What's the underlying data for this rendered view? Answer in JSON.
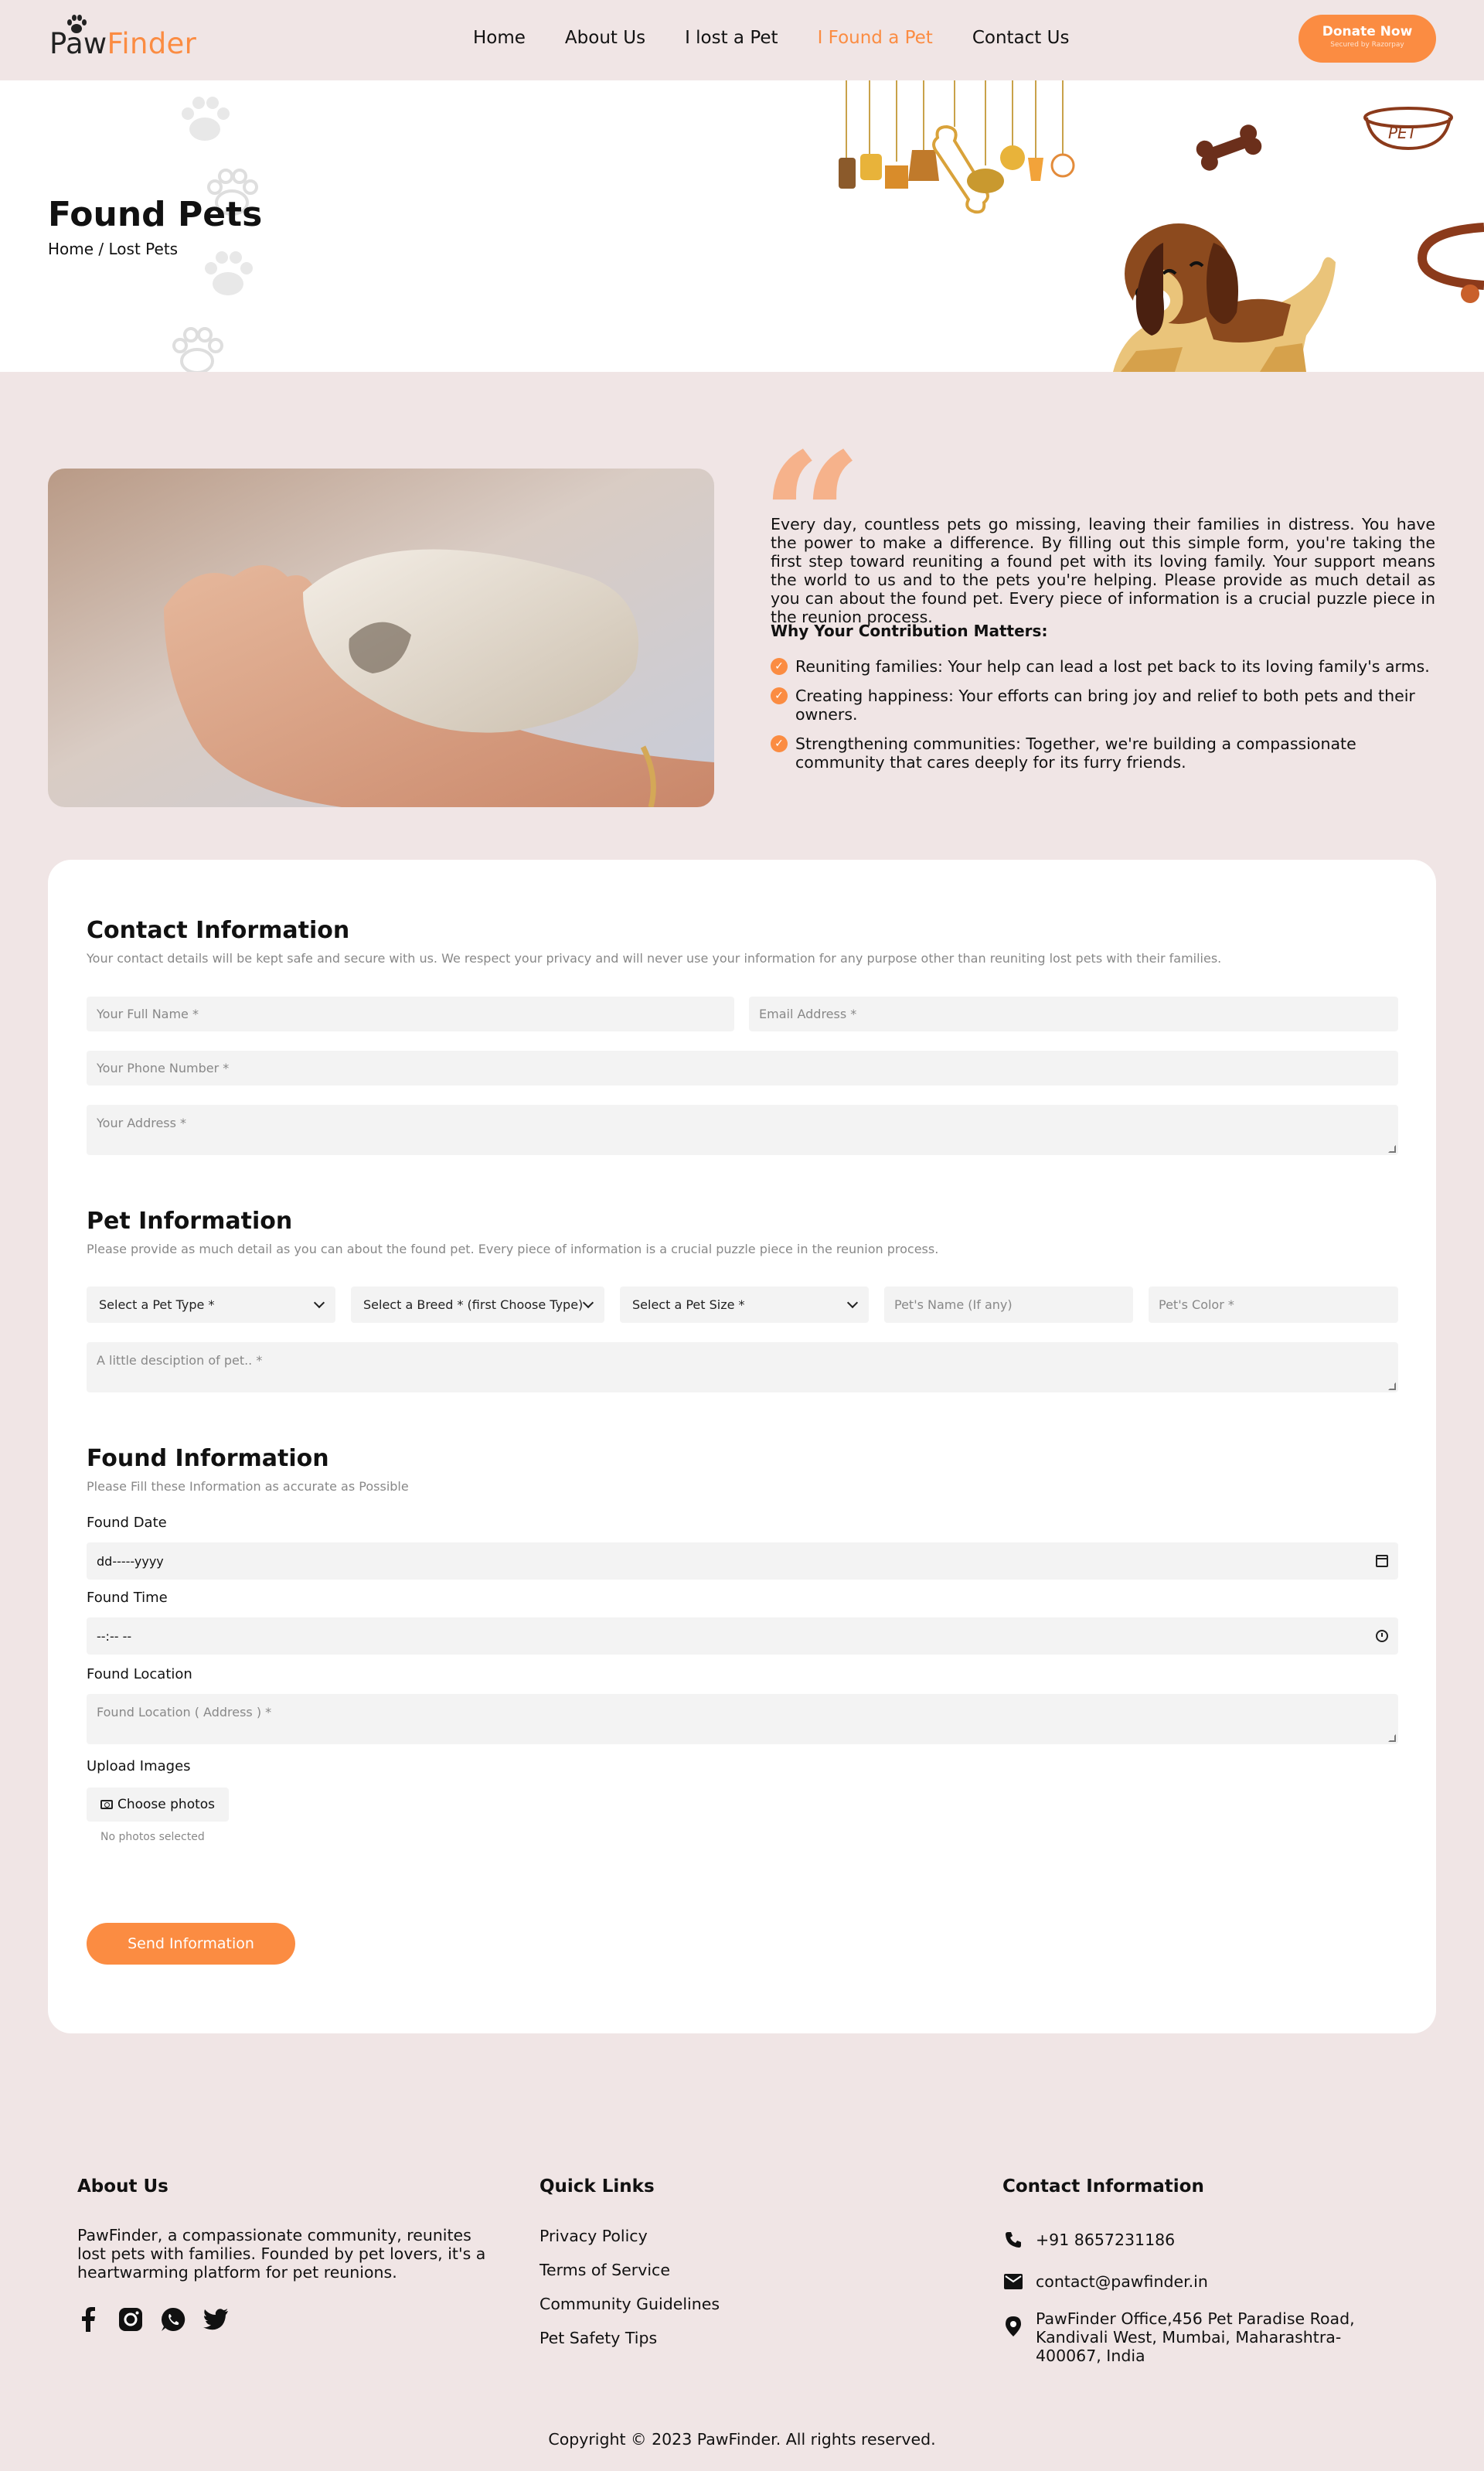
{
  "brand": {
    "logo_part1": "Paw",
    "logo_part2": "Finder",
    "accent": "#fb8c42",
    "background": "#f0e5e5"
  },
  "nav": {
    "items": [
      "Home",
      "About Us",
      "I lost a Pet",
      "I Found a Pet",
      "Contact Us"
    ],
    "active": "I Found a Pet"
  },
  "donate": {
    "label": "Donate Now",
    "sub": "Secured by Razorpay"
  },
  "hero": {
    "title": "Found Pets",
    "breadcrumb": "Home / Lost Pets",
    "bowl_label": "PET"
  },
  "intro": {
    "paragraph": "Every day, countless pets go missing, leaving their families in distress. You have the power to make a difference. By filling out this simple form, you're taking the first step toward reuniting a found pet with its loving family. Your support means the world to us and to the pets you're helping. Please provide as much detail as you can about the found pet. Every piece of information is a crucial puzzle piece in the reunion process.",
    "why_title": "Why Your Contribution Matters:",
    "benefits": [
      "Reuniting families: Your help can lead a lost pet back to its loving family's arms.",
      "Creating happiness: Your efforts can bring joy and relief to both pets and their owners.",
      "Strengthening communities: Together, we're building a compassionate community that cares deeply for its furry friends."
    ]
  },
  "contact_section": {
    "title": "Contact Information",
    "subtitle": "Your contact details will be kept safe and secure with us. We respect your privacy and will never use your information for any purpose other than reuniting lost pets with their families.",
    "full_name_placeholder": "Your Full Name *",
    "email_placeholder": "Email Address *",
    "phone_placeholder": "Your Phone Number *",
    "address_placeholder": "Your Address *"
  },
  "pet_section": {
    "title": "Pet Information",
    "subtitle": "Please provide as much detail as you can about the found pet. Every piece of information is a crucial puzzle piece in the reunion process.",
    "type_select": "Select a Pet Type *",
    "breed_select": "Select a Breed * (first Choose Type)",
    "size_select": "Select a Pet Size *",
    "name_placeholder": "Pet's Name (If any)",
    "color_placeholder": "Pet's Color *",
    "description_placeholder": "A little desciption of pet.. *"
  },
  "found_section": {
    "title": "Found Information",
    "subtitle": "Please Fill these Information as accurate as Possible",
    "date_label": "Found Date",
    "date_value": "dd-----yyyy",
    "time_label": "Found Time",
    "time_value": "--:-- --",
    "location_label": "Found Location",
    "location_placeholder": "Found Location ( Address ) *",
    "upload_label": "Upload Images",
    "choose_label": "Choose photos",
    "no_photos": "No photos selected",
    "send_label": "Send Information"
  },
  "footer": {
    "about_title": "About Us",
    "about_text": "PawFinder, a compassionate community, reunites lost pets with families. Founded by pet lovers, it's a heartwarming platform for pet reunions.",
    "links_title": "Quick Links",
    "links": [
      "Privacy Policy",
      "Terms of Service",
      "Community Guidelines",
      "Pet Safety Tips"
    ],
    "contact_title": "Contact Information",
    "phone": "+91 8657231186",
    "email": "contact@pawfinder.in",
    "address": "PawFinder Office,456 Pet Paradise Road, Kandivali West, Mumbai, Maharashtra-400067, India",
    "copyright": "Copyright © 2023 PawFinder. All rights reserved."
  }
}
